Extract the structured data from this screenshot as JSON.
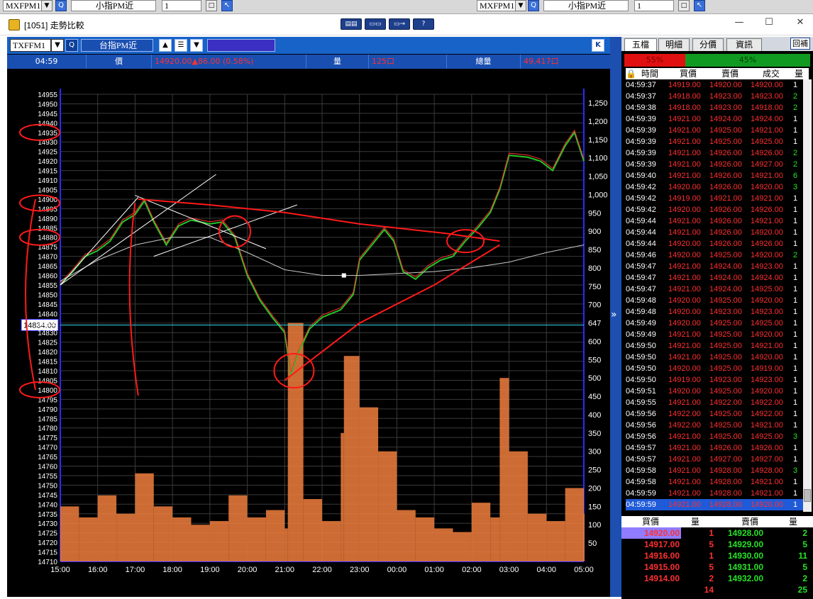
{
  "topstrip": {
    "sym1": "MXFPM1",
    "name1": "小指PM近",
    "qty1": "1",
    "sym2": "MXFPM1",
    "name2": "小指PM近",
    "qty2": "1"
  },
  "window": {
    "title": "[1051] 走勢比較",
    "minimize": "—",
    "maximize": "☐",
    "close": "✕"
  },
  "toolbar": {
    "symbol": "TXFFM1",
    "name": "台指PM近",
    "k_button": "K"
  },
  "infobar": {
    "time": "04:59",
    "price_label": "價",
    "price_value": "14920.00▲86.00 (0.58%)",
    "vol_label": "量",
    "vol_value": "125口",
    "total_label": "總量",
    "total_value": "49,417口"
  },
  "chart_data": {
    "type": "line",
    "title": "",
    "x_ticks": [
      "15:00",
      "16:00",
      "17:00",
      "18:00",
      "19:00",
      "20:00",
      "21:00",
      "22:00",
      "23:00",
      "00:00",
      "01:00",
      "02:00",
      "03:00",
      "04:00",
      "05:00"
    ],
    "price_ticks": [
      14955,
      14950,
      14945,
      14940,
      14935,
      14930,
      14925,
      14920,
      14915,
      14910,
      14905,
      14900,
      14895,
      14890,
      14885,
      14880,
      14875,
      14870,
      14865,
      14860,
      14855,
      14850,
      14845,
      14840,
      14835,
      14830,
      14825,
      14820,
      14815,
      14810,
      14805,
      14800,
      14795,
      14790,
      14785,
      14780,
      14775,
      14770,
      14765,
      14760,
      14755,
      14750,
      14745,
      14740,
      14735,
      14730,
      14725,
      14720,
      14715,
      14710
    ],
    "volume_ticks": [
      1250,
      1200,
      1150,
      1100,
      1050,
      1000,
      950,
      900,
      850,
      800,
      750,
      700,
      650,
      600,
      550,
      500,
      450,
      400,
      350,
      300,
      250,
      200,
      150,
      100,
      50
    ],
    "volume_tick_labels": [
      "1,250",
      "1,200",
      "1,150",
      "1,100",
      "1,050",
      "1,000",
      "950",
      "900",
      "850",
      "800",
      "750",
      "700",
      "647",
      "600",
      "550",
      "500",
      "450",
      "400",
      "350",
      "300",
      "250",
      "200",
      "150",
      "100",
      "50"
    ],
    "price_range": [
      14710,
      14955
    ],
    "volume_range": [
      0,
      1250
    ],
    "reference_price": 14834.0,
    "reference_price_label": "14834.00",
    "reference_volume_label": "647",
    "price_series": [
      [
        "15:00",
        14855
      ],
      [
        "15:20",
        14862
      ],
      [
        "15:40",
        14870
      ],
      [
        "16:00",
        14873
      ],
      [
        "16:20",
        14878
      ],
      [
        "16:40",
        14888
      ],
      [
        "17:00",
        14892
      ],
      [
        "17:15",
        14899
      ],
      [
        "17:30",
        14888
      ],
      [
        "17:50",
        14876
      ],
      [
        "18:10",
        14886
      ],
      [
        "18:30",
        14889
      ],
      [
        "19:00",
        14887
      ],
      [
        "19:20",
        14888
      ],
      [
        "19:40",
        14880
      ],
      [
        "20:00",
        14860
      ],
      [
        "20:20",
        14847
      ],
      [
        "20:40",
        14838
      ],
      [
        "21:00",
        14830
      ],
      [
        "21:10",
        14808
      ],
      [
        "21:20",
        14818
      ],
      [
        "21:40",
        14832
      ],
      [
        "22:00",
        14838
      ],
      [
        "22:30",
        14842
      ],
      [
        "22:50",
        14850
      ],
      [
        "23:00",
        14868
      ],
      [
        "23:20",
        14876
      ],
      [
        "23:40",
        14884
      ],
      [
        "23:55",
        14878
      ],
      [
        "00:10",
        14862
      ],
      [
        "00:30",
        14858
      ],
      [
        "00:50",
        14864
      ],
      [
        "01:10",
        14868
      ],
      [
        "01:30",
        14870
      ],
      [
        "01:50",
        14878
      ],
      [
        "02:10",
        14885
      ],
      [
        "02:30",
        14893
      ],
      [
        "02:45",
        14905
      ],
      [
        "03:00",
        14923
      ],
      [
        "03:30",
        14922
      ],
      [
        "03:50",
        14920
      ],
      [
        "04:10",
        14915
      ],
      [
        "04:30",
        14928
      ],
      [
        "04:45",
        14935
      ],
      [
        "05:00",
        14920
      ]
    ],
    "avg_series": [
      [
        "15:00",
        14857
      ],
      [
        "16:00",
        14868
      ],
      [
        "17:00",
        14876
      ],
      [
        "18:00",
        14880
      ],
      [
        "19:00",
        14880
      ],
      [
        "20:00",
        14872
      ],
      [
        "21:00",
        14863
      ],
      [
        "22:00",
        14860
      ],
      [
        "22:30",
        14860
      ],
      [
        "23:00",
        14860
      ],
      [
        "00:00",
        14861
      ],
      [
        "01:00",
        14862
      ],
      [
        "02:00",
        14864
      ],
      [
        "03:00",
        14867
      ],
      [
        "04:00",
        14872
      ],
      [
        "05:00",
        14876
      ]
    ],
    "volume_series": [
      [
        "15:00",
        150
      ],
      [
        "15:30",
        120
      ],
      [
        "16:00",
        180
      ],
      [
        "16:30",
        130
      ],
      [
        "17:00",
        240
      ],
      [
        "17:30",
        150
      ],
      [
        "18:00",
        120
      ],
      [
        "18:30",
        100
      ],
      [
        "19:00",
        110
      ],
      [
        "19:30",
        180
      ],
      [
        "20:00",
        120
      ],
      [
        "20:30",
        140
      ],
      [
        "21:00",
        90
      ],
      [
        "21:05",
        650
      ],
      [
        "21:30",
        170
      ],
      [
        "22:00",
        110
      ],
      [
        "22:30",
        350
      ],
      [
        "22:35",
        560
      ],
      [
        "23:00",
        420
      ],
      [
        "23:30",
        300
      ],
      [
        "00:00",
        140
      ],
      [
        "00:30",
        120
      ],
      [
        "01:00",
        90
      ],
      [
        "01:30",
        80
      ],
      [
        "02:00",
        160
      ],
      [
        "02:30",
        120
      ],
      [
        "02:45",
        500
      ],
      [
        "03:00",
        300
      ],
      [
        "03:30",
        130
      ],
      [
        "04:00",
        110
      ],
      [
        "04:30",
        200
      ],
      [
        "05:00",
        130
      ]
    ]
  },
  "right": {
    "tabs": [
      "五檔",
      "明細",
      "分價",
      "資訊"
    ],
    "extra_button": "回補",
    "buy_ratio_label": "55%",
    "buy_ratio": 0.55,
    "sell_ratio_label": "45%",
    "columns": [
      "時間",
      "買價",
      "賣價",
      "成交",
      "量"
    ],
    "ticks": [
      [
        "04:59:37",
        "14919.00",
        "14920.00",
        "14920.00",
        "1"
      ],
      [
        "04:59:37",
        "14918.00",
        "14923.00",
        "14923.00",
        "2"
      ],
      [
        "04:59:38",
        "14918.00",
        "14923.00",
        "14918.00",
        "2"
      ],
      [
        "04:59:39",
        "14921.00",
        "14924.00",
        "14924.00",
        "1"
      ],
      [
        "04:59:39",
        "14921.00",
        "14925.00",
        "14921.00",
        "1"
      ],
      [
        "04:59:39",
        "14921.00",
        "14925.00",
        "14925.00",
        "1"
      ],
      [
        "04:59:39",
        "14921.00",
        "14926.00",
        "14926.00",
        "2"
      ],
      [
        "04:59:39",
        "14921.00",
        "14926.00",
        "14927.00",
        "2"
      ],
      [
        "04:59:40",
        "14921.00",
        "14926.00",
        "14921.00",
        "6"
      ],
      [
        "04:59:42",
        "14920.00",
        "14926.00",
        "14920.00",
        "3"
      ],
      [
        "04:59:42",
        "14919.00",
        "14921.00",
        "14921.00",
        "1"
      ],
      [
        "04:59:42",
        "14920.00",
        "14926.00",
        "14926.00",
        "1"
      ],
      [
        "04:59:44",
        "14921.00",
        "14926.00",
        "14921.00",
        "1"
      ],
      [
        "04:59:44",
        "14921.00",
        "14926.00",
        "14920.00",
        "1"
      ],
      [
        "04:59:44",
        "14920.00",
        "14926.00",
        "14926.00",
        "1"
      ],
      [
        "04:59:46",
        "14920.00",
        "14925.00",
        "14920.00",
        "2"
      ],
      [
        "04:59:47",
        "14921.00",
        "14924.00",
        "14923.00",
        "1"
      ],
      [
        "04:59:47",
        "14921.00",
        "14924.00",
        "14924.00",
        "1"
      ],
      [
        "04:59:47",
        "14921.00",
        "14924.00",
        "14925.00",
        "1"
      ],
      [
        "04:59:48",
        "14920.00",
        "14925.00",
        "14920.00",
        "1"
      ],
      [
        "04:59:48",
        "14920.00",
        "14923.00",
        "14923.00",
        "1"
      ],
      [
        "04:59:49",
        "14920.00",
        "14925.00",
        "14925.00",
        "1"
      ],
      [
        "04:59:49",
        "14921.00",
        "14925.00",
        "14920.00",
        "1"
      ],
      [
        "04:59:50",
        "14921.00",
        "14925.00",
        "14921.00",
        "1"
      ],
      [
        "04:59:50",
        "14921.00",
        "14925.00",
        "14920.00",
        "1"
      ],
      [
        "04:59:50",
        "14920.00",
        "14925.00",
        "14919.00",
        "1"
      ],
      [
        "04:59:50",
        "14919.00",
        "14923.00",
        "14923.00",
        "1"
      ],
      [
        "04:59:51",
        "14920.00",
        "14925.00",
        "14920.00",
        "1"
      ],
      [
        "04:59:55",
        "14921.00",
        "14922.00",
        "14922.00",
        "1"
      ],
      [
        "04:59:56",
        "14922.00",
        "14925.00",
        "14922.00",
        "1"
      ],
      [
        "04:59:56",
        "14922.00",
        "14925.00",
        "14921.00",
        "1"
      ],
      [
        "04:59:56",
        "14921.00",
        "14925.00",
        "14925.00",
        "3"
      ],
      [
        "04:59:57",
        "14921.00",
        "14926.00",
        "14926.00",
        "1"
      ],
      [
        "04:59:57",
        "14921.00",
        "14927.00",
        "14927.00",
        "1"
      ],
      [
        "04:59:58",
        "14921.00",
        "14928.00",
        "14928.00",
        "3"
      ],
      [
        "04:59:58",
        "14921.00",
        "14928.00",
        "14921.00",
        "1"
      ],
      [
        "04:59:59",
        "14921.00",
        "14928.00",
        "14921.00",
        "1"
      ],
      [
        "04:59:59",
        "14921.00",
        "14928.00",
        "14920.00",
        "1"
      ]
    ],
    "book_columns": [
      "買價",
      "量",
      "賣價",
      "量"
    ],
    "book": [
      [
        "14920.00",
        "1",
        "14928.00",
        "2"
      ],
      [
        "14917.00",
        "5",
        "14929.00",
        "5"
      ],
      [
        "14916.00",
        "1",
        "14930.00",
        "11"
      ],
      [
        "14915.00",
        "5",
        "14931.00",
        "5"
      ],
      [
        "14914.00",
        "2",
        "14932.00",
        "2"
      ]
    ],
    "book_total_bid": "14",
    "book_total_ask": "25"
  },
  "colors": {
    "chart_bg": "#000000",
    "axis_blue": "#2a2aff",
    "grid": "#3a3a3a",
    "price_up": "#ff3030",
    "price_down": "#27c427",
    "volume": "#f07e3c",
    "avg_line": "#c8c8c8",
    "annotation": "#ff1a1a"
  }
}
